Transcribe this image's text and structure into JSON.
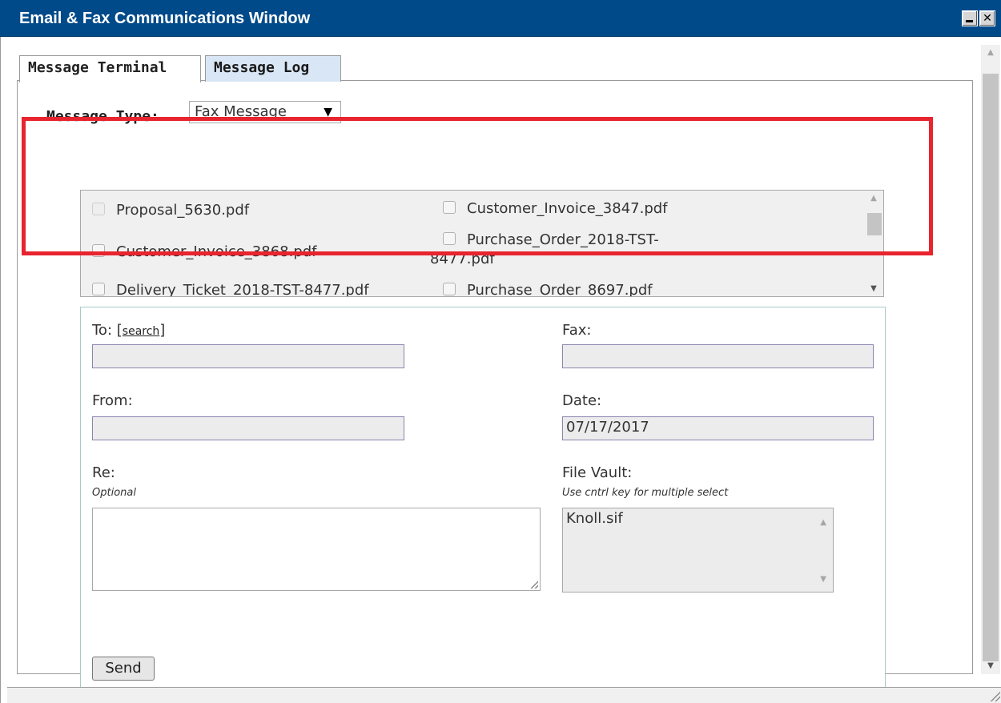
{
  "window": {
    "title": "Email & Fax Communications Window",
    "minimize_glyph": "_",
    "close_glyph": "✕"
  },
  "tabs": [
    {
      "label": "Message Terminal",
      "active": true
    },
    {
      "label": "Message Log",
      "active": false
    }
  ],
  "message_type": {
    "label": "Message Type:",
    "selected": "Fax Message",
    "caret": "▼"
  },
  "attachments": {
    "files": [
      {
        "name": "Proposal_5630.pdf",
        "checked": false,
        "disabled": true
      },
      {
        "name": "Customer_Invoice_3847.pdf",
        "checked": false,
        "disabled": false
      },
      {
        "name": "Customer_Invoice_3868.pdf",
        "checked": false,
        "disabled": false
      },
      {
        "name_line1": "Purchase_Order_2018-TST-",
        "name_line2": "8477.pdf",
        "checked": false,
        "disabled": false
      },
      {
        "name": "Delivery_Ticket_2018-TST-8477.pdf",
        "checked": false,
        "disabled": false
      },
      {
        "name": "Purchase_Order_8697.pdf",
        "checked": false,
        "disabled": false
      }
    ]
  },
  "form": {
    "to_label": "To:",
    "search_open": "[",
    "search_link": "search",
    "search_close": "]",
    "to_value": "",
    "fax_label": "Fax:",
    "fax_value": "",
    "from_label": "From:",
    "from_value": "",
    "date_label": "Date:",
    "date_value": "07/17/2017",
    "re_label": "Re:",
    "re_hint": "Optional",
    "re_value": "",
    "vault_label": "File Vault:",
    "vault_hint": "Use cntrl key for multiple select",
    "vault_items": [
      "Knoll.sif"
    ],
    "send_label": "Send"
  },
  "icons": {
    "scroll_up": "▲",
    "scroll_down": "▼"
  },
  "colors": {
    "titlebar": "#004a8a",
    "highlight": "#e8242e",
    "inactive_tab": "#d9e6f5"
  }
}
